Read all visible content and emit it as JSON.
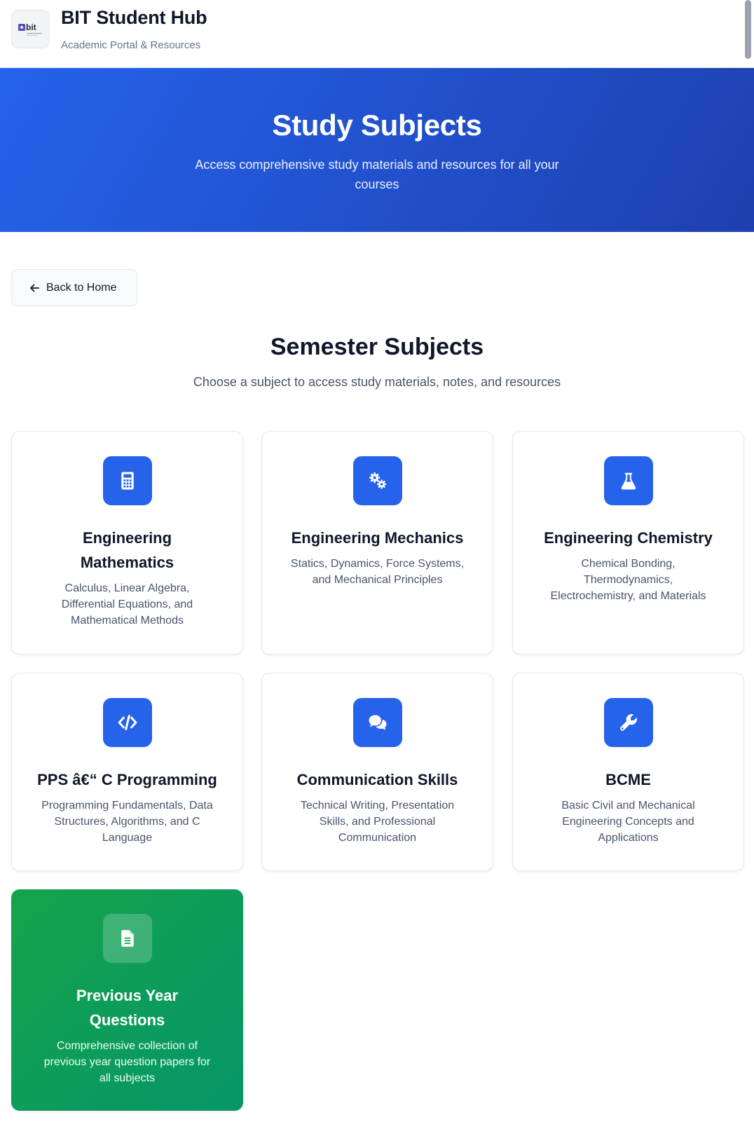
{
  "header": {
    "title": "BIT Student Hub",
    "subtitle": "Academic Portal & Resources",
    "logo_text": "bit"
  },
  "hero": {
    "title": "Study Subjects",
    "description": "Access comprehensive study materials and resources for all your courses"
  },
  "back_button": {
    "label": "Back to Home"
  },
  "section": {
    "title": "Semester Subjects",
    "subtitle": "Choose a subject to access study materials, notes, and resources"
  },
  "subjects": [
    {
      "title": "Engineering Mathematics",
      "description": "Calculus, Linear Algebra, Differential Equations, and Mathematical Methods",
      "icon": "calculator-icon"
    },
    {
      "title": "Engineering Mechanics",
      "description": "Statics, Dynamics, Force Systems, and Mechanical Principles",
      "icon": "gears-icon"
    },
    {
      "title": "Engineering Chemistry",
      "description": "Chemical Bonding, Thermodynamics, Electrochemistry, and Materials",
      "icon": "flask-icon"
    },
    {
      "title": "PPS â€“ C Programming",
      "description": "Programming Fundamentals, Data Structures, Algorithms, and C Language",
      "icon": "code-icon"
    },
    {
      "title": "Communication Skills",
      "description": "Technical Writing, Presentation Skills, and Professional Communication",
      "icon": "chat-bubbles-icon"
    },
    {
      "title": "BCME",
      "description": "Basic Civil and Mechanical Engineering Concepts and Applications",
      "icon": "wrench-icon"
    },
    {
      "title": "Previous Year Questions",
      "description": "Comprehensive collection of previous year question papers for all subjects",
      "icon": "document-icon"
    }
  ],
  "colors": {
    "primary": "#2563eb",
    "hero_end": "#1e40af",
    "pyq_green": "#16a34a",
    "text_dark": "#0f172a",
    "text_muted": "#475569"
  }
}
